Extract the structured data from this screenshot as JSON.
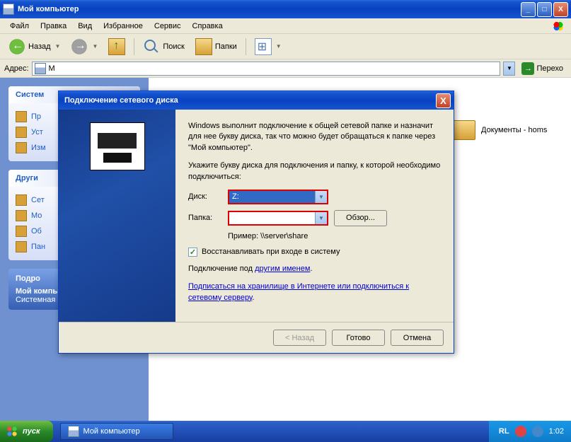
{
  "window": {
    "title": "Мой компьютер",
    "min": "_",
    "max": "□",
    "close": "X"
  },
  "menu": {
    "file": "Файл",
    "edit": "Правка",
    "view": "Вид",
    "favorites": "Избранное",
    "tools": "Сервис",
    "help": "Справка"
  },
  "toolbar": {
    "back": "Назад",
    "search": "Поиск",
    "folders": "Папки"
  },
  "address": {
    "label": "Адрес:",
    "value": "М",
    "go": "Перехо"
  },
  "sidepanel": {
    "box1": {
      "header": "Систем",
      "items": [
        "Пр",
        "Уст",
        "Изм"
      ]
    },
    "box2": {
      "header": "Други",
      "items": [
        "Сет",
        "Мо",
        "Об",
        "Пан"
      ]
    },
    "box3": {
      "header": "Подро",
      "name": "Мой компьютер",
      "type": "Системная папка"
    }
  },
  "mainarea": {
    "folder1": "Документы - homs"
  },
  "dialog": {
    "title": "Подключение сетевого диска",
    "close": "X",
    "intro": "Windows выполнит подключение к общей сетевой папке и назначит для нее букву диска, так что можно будет обращаться к папке через \"Мой компьютер\".",
    "instruction": "Укажите букву диска для подключения и папку, к которой необходимо подключиться:",
    "disk_label": "Диск:",
    "disk_value": "Z:",
    "folder_label": "Папка:",
    "folder_value": "",
    "browse": "Обзор...",
    "example": "Пример: \\\\server\\share",
    "reconnect": "Восстанавливать при входе в систему",
    "connect_as_pre": "Подключение под ",
    "connect_as_link": "другим именем",
    "signup_link": "Подписаться на хранилище в Интернете или подключиться к сетевому серверу",
    "btn_back": "< Назад",
    "btn_finish": "Готово",
    "btn_cancel": "Отмена"
  },
  "taskbar": {
    "start": "пуск",
    "task1": "Мой компьютер",
    "lang": "RL",
    "time": "1:02"
  }
}
